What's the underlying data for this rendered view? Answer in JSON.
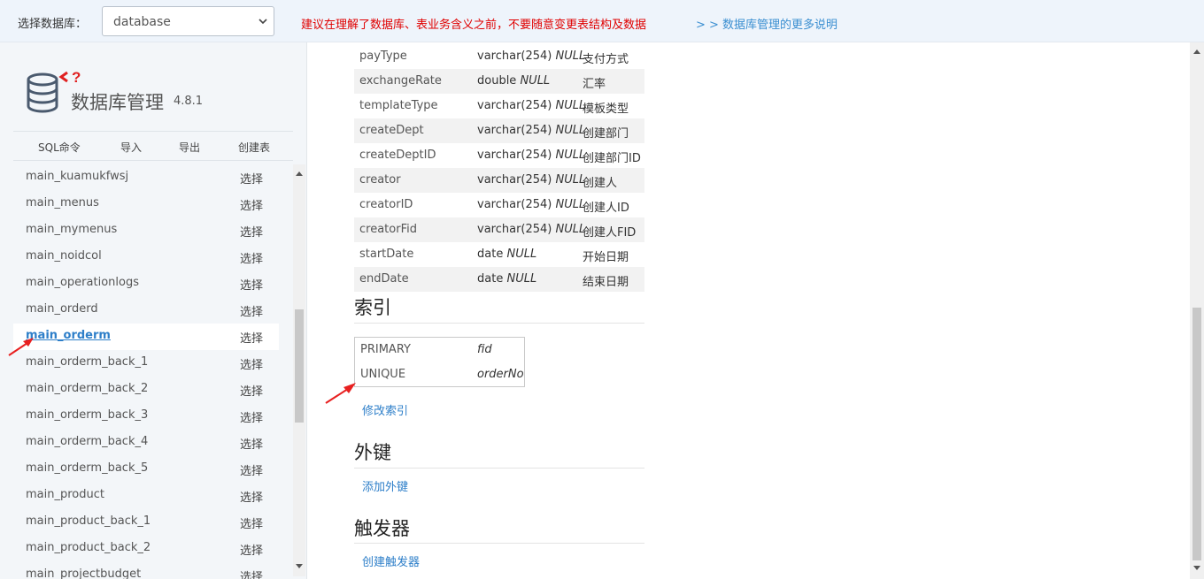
{
  "header": {
    "db_label": "选择数据库：",
    "db_value": "database",
    "warning": "建议在理解了数据库、表业务含义之前，不要随意变更表结构及数据",
    "more_link": "> > 数据库管理的更多说明"
  },
  "sidebar": {
    "title": "数据库管理",
    "version": "4.8.1",
    "toolbar": [
      "SQL命令",
      "导入",
      "导出",
      "创建表"
    ],
    "select_label": "选择",
    "active_table": "main_orderm",
    "tables": [
      "main_kuamukfwsj",
      "main_menus",
      "main_mymenus",
      "main_noidcol",
      "main_operationlogs",
      "main_orderd",
      "main_orderm",
      "main_orderm_back_1",
      "main_orderm_back_2",
      "main_orderm_back_3",
      "main_orderm_back_4",
      "main_orderm_back_5",
      "main_product",
      "main_product_back_1",
      "main_product_back_2",
      "main_projectbudget"
    ]
  },
  "columns": [
    {
      "name": "payType",
      "type": "varchar(254)",
      "null": "NULL",
      "comment": "支付方式"
    },
    {
      "name": "exchangeRate",
      "type": "double",
      "null": "NULL",
      "comment": "汇率"
    },
    {
      "name": "templateType",
      "type": "varchar(254)",
      "null": "NULL",
      "comment": "模板类型"
    },
    {
      "name": "createDept",
      "type": "varchar(254)",
      "null": "NULL",
      "comment": "创建部门"
    },
    {
      "name": "createDeptID",
      "type": "varchar(254)",
      "null": "NULL",
      "comment": "创建部门ID"
    },
    {
      "name": "creator",
      "type": "varchar(254)",
      "null": "NULL",
      "comment": "创建人"
    },
    {
      "name": "creatorID",
      "type": "varchar(254)",
      "null": "NULL",
      "comment": "创建人ID"
    },
    {
      "name": "creatorFid",
      "type": "varchar(254)",
      "null": "NULL",
      "comment": "创建人FID"
    },
    {
      "name": "startDate",
      "type": "date",
      "null": "NULL",
      "comment": "开始日期"
    },
    {
      "name": "endDate",
      "type": "date",
      "null": "NULL",
      "comment": "结束日期"
    }
  ],
  "indexes": {
    "heading": "索引",
    "rows": [
      {
        "type": "PRIMARY",
        "column": "fid"
      },
      {
        "type": "UNIQUE",
        "column": "orderNo"
      }
    ],
    "edit_link": "修改索引"
  },
  "foreign_keys": {
    "heading": "外键",
    "add_link": "添加外键"
  },
  "triggers": {
    "heading": "触发器",
    "create_link": "创建触发器"
  },
  "colors": {
    "accent": "#2e7fc9",
    "warning": "#e00000",
    "annotation": "#e82020"
  }
}
